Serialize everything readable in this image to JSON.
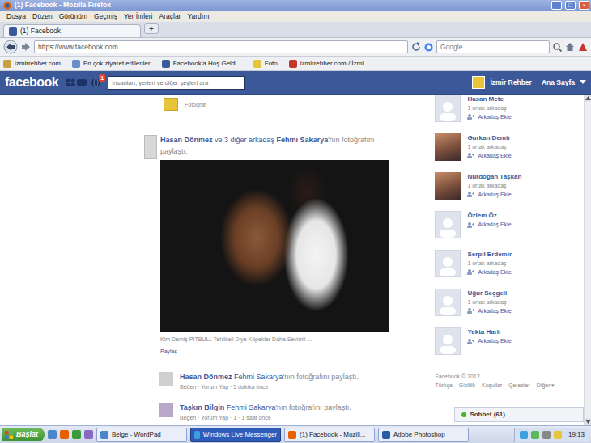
{
  "window": {
    "title": "(1) Facebook - Mozilla Firefox",
    "controls": [
      "–",
      "□",
      "×"
    ]
  },
  "menu": [
    "Dosya",
    "Düzen",
    "Görünüm",
    "Geçmiş",
    "Yer İmleri",
    "Araçlar",
    "Yardım"
  ],
  "tabs": [
    {
      "label": "(1) Facebook",
      "selected": true
    }
  ],
  "new_tab": "+",
  "address": {
    "url": "https://www.facebook.com"
  },
  "search": {
    "placeholder": "Google"
  },
  "bookmarks": [
    "izmirrehber.com",
    "En çok ziyaret edilenler",
    "Facebook'a Hoş Geldi...",
    "Foto",
    "izmirrehber.com / İzmi..."
  ],
  "facebook": {
    "logo": "facebook",
    "notifications": "1",
    "search_placeholder": "İnsanları, yerleri ve diğer şeyleri ara",
    "user": "İzmir Rehber",
    "home": "Ana Sayfa"
  },
  "feed": {
    "top_item": "Fotoğraf",
    "post": {
      "author": "Hasan Dönmez",
      "middle": "ve 3 diğer arkadaş",
      "owner": "Fehmi Sakarya",
      "tail": "'nın fotoğrafını paylaştı.",
      "caption": "Kim Demiş PITBULL Tehlikeli Diye Köpekler Daha Sevimli ...",
      "share": "Paylaş"
    },
    "shares": [
      {
        "author": "Hasan Dönmez",
        "owner": "Fehmi Sakarya",
        "tail": "'nın fotoğrafını paylaştı.",
        "meta": "Beğen · Yorum Yap · 5 dakika önce"
      },
      {
        "author": "Taşkın Bilgin",
        "owner": "Fehmi Sakarya",
        "tail": "'nın fotoğrafını paylaştı.",
        "meta": "Beğen · Yorum Yap · 1 · 1 saat önce"
      }
    ]
  },
  "suggestions": [
    {
      "name": "Hasan Mete",
      "mutual": "1 ortak arkadaş",
      "action": "Arkadaş Ekle",
      "kind": "silhouette"
    },
    {
      "name": "Gurkan Demir",
      "mutual": "1 ortak arkadaş",
      "action": "Arkadaş Ekle",
      "kind": "photo"
    },
    {
      "name": "Nurdoğan Taşkan",
      "mutual": "1 ortak arkadaş",
      "action": "Arkadaş Ekle",
      "kind": "photo"
    },
    {
      "name": "Özlem Öz",
      "action": "Arkadaş Ekle",
      "kind": "silhouette"
    },
    {
      "name": "Serpil Erdemir",
      "mutual": "1 ortak arkadaş",
      "action": "Arkadaş Ekle",
      "kind": "silhouette"
    },
    {
      "name": "Uğur Seçgeli",
      "mutual": "1 ortak arkadaş",
      "action": "Arkadaş Ekle",
      "kind": "silhouette"
    },
    {
      "name": "Yekta Harlı",
      "action": "Arkadaş Ekle",
      "kind": "silhouette"
    }
  ],
  "footer": {
    "copyright": "Facebook © 2012",
    "links": [
      "Türkçe",
      "Gizlilik",
      "Koşullar",
      "Çerezler",
      "Diğer ▾"
    ]
  },
  "chat": "Sohbet (61)",
  "taskbar": {
    "start": "Başlat",
    "tasks": [
      {
        "label": "Belge - WordPad",
        "highlighted": false
      },
      {
        "label": "Windows Live Messenger",
        "highlighted": true
      },
      {
        "label": "(1) Facebook - Mozill...",
        "highlighted": false
      },
      {
        "label": "Adobe Photoshop",
        "highlighted": false
      }
    ],
    "clock": "19:13"
  }
}
